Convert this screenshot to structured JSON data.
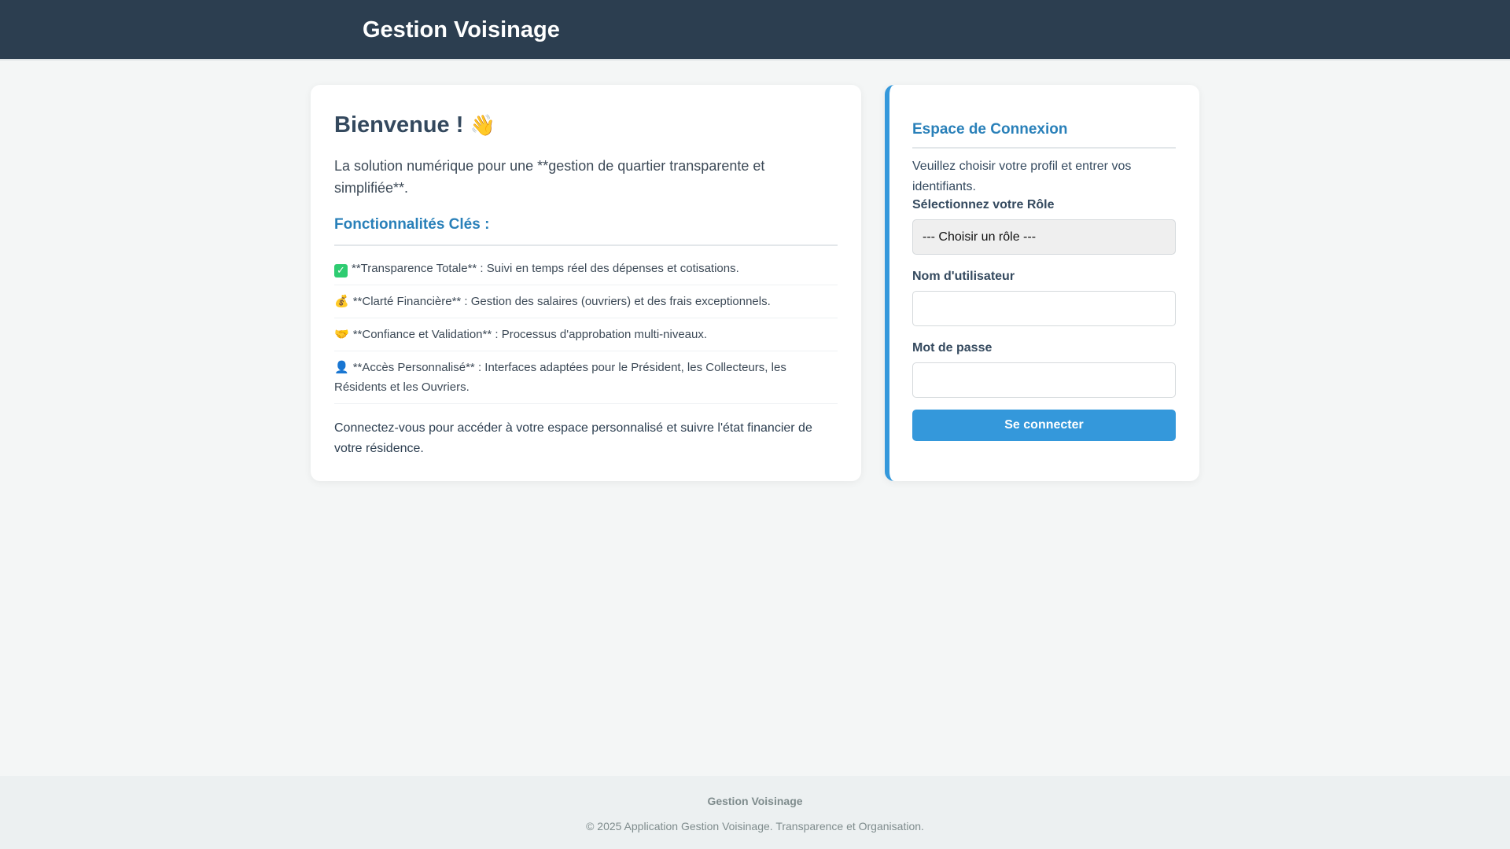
{
  "header": {
    "brand": "Gestion Voisinage"
  },
  "welcome": {
    "title": "Bienvenue !",
    "title_emoji": "👋",
    "intro": "La solution numérique pour une **gestion de quartier transparente et simplifiée**.",
    "features_title": "Fonctionnalités Clés :",
    "features": [
      {
        "icon": "check-mark-icon",
        "glyph": "✓",
        "text": "**Transparence Totale** : Suivi en temps réel des dépenses et cotisations."
      },
      {
        "icon": "money-bag-icon",
        "glyph": "💰",
        "text": "**Clarté Financière** : Gestion des salaires (ouvriers) et des frais exceptionnels."
      },
      {
        "icon": "handshake-icon",
        "glyph": "🤝",
        "text": "**Confiance et Validation** : Processus d'approbation multi-niveaux."
      },
      {
        "icon": "person-icon",
        "glyph": "👤",
        "text": "**Accès Personnalisé** : Interfaces adaptées pour le Président, les Collecteurs, les Résidents et les Ouvriers."
      }
    ],
    "outro": "Connectez-vous pour accéder à votre espace personnalisé et suivre l'état financier de votre résidence."
  },
  "login": {
    "title": "Espace de Connexion",
    "description": "Veuillez choisir votre profil et entrer vos identifiants.",
    "role_label": "Sélectionnez votre Rôle",
    "role_selected": "--- Choisir un rôle ---",
    "username_label": "Nom d'utilisateur",
    "username_value": "",
    "password_label": "Mot de passe",
    "password_value": "",
    "submit_label": "Se connecter"
  },
  "footer": {
    "brand": "Gestion Voisinage",
    "copyright": "© 2025 Application Gestion Voisinage. Transparence et Organisation."
  },
  "colors": {
    "header_bg": "#2c3e50",
    "accent": "#3498db",
    "section_title": "#2980b9",
    "page_bg": "#f4f6f6",
    "footer_bg": "#ecf0f1"
  }
}
